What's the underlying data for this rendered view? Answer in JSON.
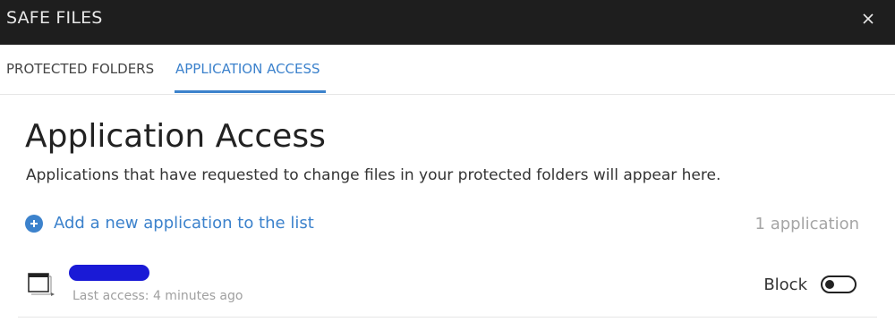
{
  "window": {
    "title": "SAFE FILES",
    "close_icon": "close-icon"
  },
  "tabs": [
    {
      "label": "PROTECTED FOLDERS",
      "selected": false
    },
    {
      "label": "APPLICATION ACCESS",
      "selected": true
    }
  ],
  "main": {
    "heading": "Application Access",
    "description": "Applications that have requested to change files in your protected folders will appear here.",
    "add_link": {
      "label": "Add a new application to the list",
      "icon": "plus-circle-icon"
    },
    "count": "1 application"
  },
  "applications": [
    {
      "icon": "application-window-icon",
      "name_redacted": true,
      "last_access": "Last access: 4 minutes ago",
      "action_label": "Block",
      "toggle_on": false
    }
  ],
  "colors": {
    "accent": "#3c82cc",
    "titlebar_bg": "#1e1e1e",
    "redaction": "#1a1ad6",
    "muted_text": "#a0a0a0"
  }
}
